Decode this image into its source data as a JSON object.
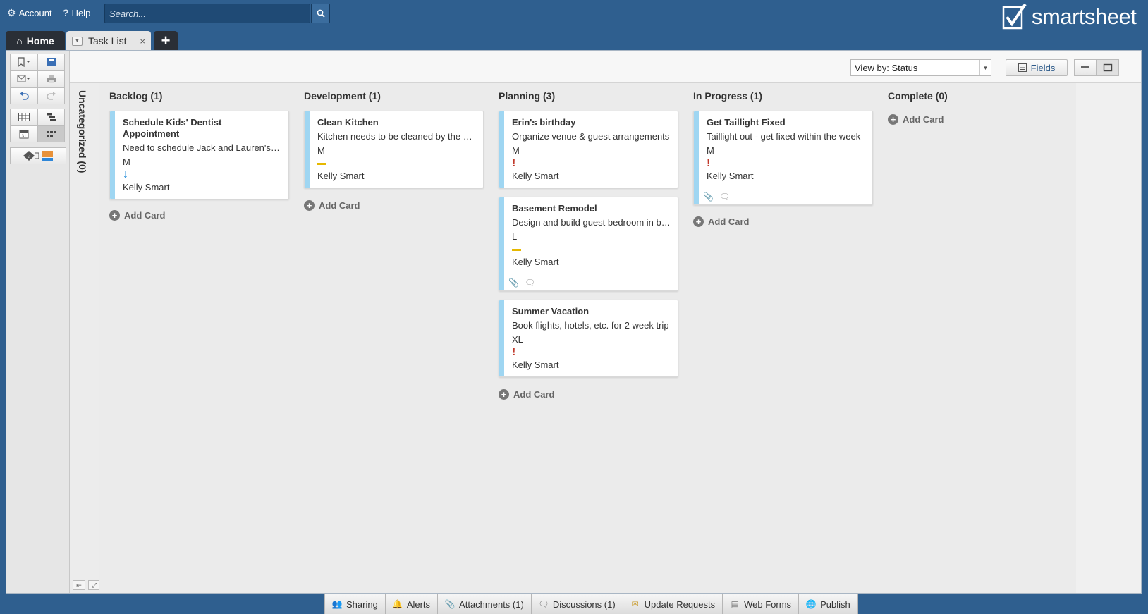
{
  "topbar": {
    "account_label": "Account",
    "help_label": "Help",
    "search_placeholder": "Search...",
    "logo_text": "smartsheet"
  },
  "tabs": {
    "home_label": "Home",
    "sheet_label": "Task List",
    "close_glyph": "×",
    "add_glyph": "+"
  },
  "board_toolbar": {
    "view_by_label": "View by: Status",
    "fields_label": "Fields"
  },
  "uncategorized_label": "Uncategorized (0)",
  "add_card_label": "Add Card",
  "lanes": [
    {
      "title": "Backlog (1)",
      "cards": [
        {
          "title_line1": "Schedule Kids' Dentist",
          "title_line2": "Appointment",
          "desc": "Need to schedule Jack and Lauren's dentist appointment",
          "size": "M",
          "priority": "low",
          "owner": "Kelly Smart",
          "has_footer": false
        }
      ]
    },
    {
      "title": "Development (1)",
      "cards": [
        {
          "title": "Clean Kitchen",
          "desc": "Kitchen needs to be cleaned by the weekend",
          "size": "M",
          "priority": "medium",
          "owner": "Kelly Smart",
          "has_footer": false
        }
      ]
    },
    {
      "title": "Planning (3)",
      "cards": [
        {
          "title": "Erin's birthday",
          "desc": "Organize venue & guest arrangements",
          "size": "M",
          "priority": "high",
          "owner": "Kelly Smart",
          "has_footer": false
        },
        {
          "title": "Basement Remodel",
          "desc": "Design and build guest bedroom in basement",
          "size": "L",
          "priority": "medium",
          "owner": "Kelly Smart",
          "has_footer": true
        },
        {
          "title": "Summer Vacation",
          "desc": "Book flights, hotels, etc. for 2 week trip",
          "size": "XL",
          "priority": "high",
          "owner": "Kelly Smart",
          "has_footer": false
        }
      ]
    },
    {
      "title": "In Progress (1)",
      "cards": [
        {
          "title": "Get Taillight Fixed",
          "desc": "Taillight out - get fixed within the week",
          "size": "M",
          "priority": "high",
          "owner": "Kelly Smart",
          "has_footer": true
        }
      ]
    },
    {
      "title": "Complete (0)",
      "cards": []
    }
  ],
  "bottombar": [
    {
      "label": "Sharing",
      "icon": "people-icon"
    },
    {
      "label": "Alerts",
      "icon": "bell-icon"
    },
    {
      "label": "Attachments (1)",
      "icon": "paperclip-icon"
    },
    {
      "label": "Discussions (1)",
      "icon": "speech-bubble-icon"
    },
    {
      "label": "Update Requests",
      "icon": "envelope-update-icon"
    },
    {
      "label": "Web Forms",
      "icon": "form-icon"
    },
    {
      "label": "Publish",
      "icon": "globe-icon"
    }
  ],
  "colors": {
    "background": "#2f5f8f",
    "card_accent": "#9fd6f2",
    "priority_low": "#1f8ad8",
    "priority_medium": "#e6b800",
    "priority_high": "#c0392b"
  }
}
